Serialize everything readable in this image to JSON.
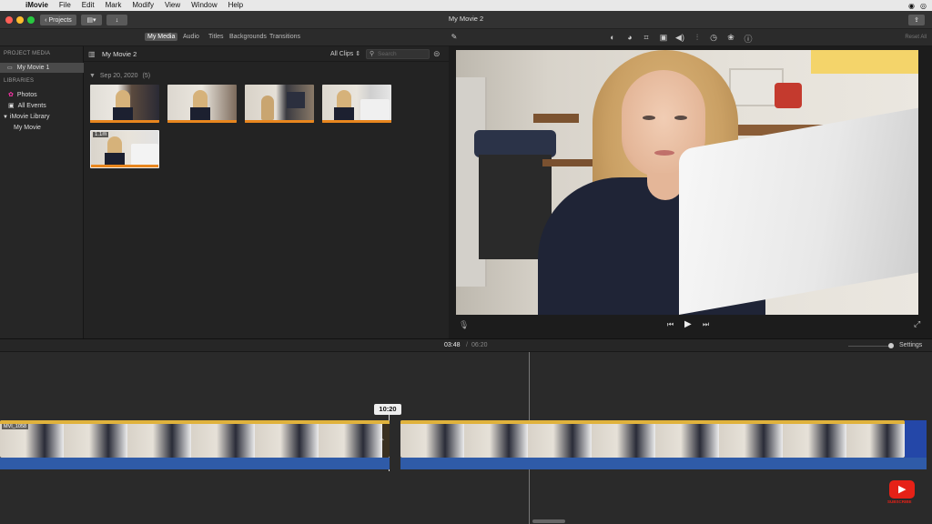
{
  "menubar": {
    "app_name": "iMovie",
    "items": [
      "File",
      "Edit",
      "Mark",
      "Modify",
      "View",
      "Window",
      "Help"
    ]
  },
  "titlebar": {
    "projects_label": "Projects",
    "title": "My Movie 2"
  },
  "media_tabs": [
    "My Media",
    "Audio",
    "Titles",
    "Backgrounds",
    "Transitions"
  ],
  "viewer_tools": {
    "reset_label": "Reset All"
  },
  "sidebar": {
    "project_media_heading": "PROJECT MEDIA",
    "project_item": "My Movie 1",
    "libraries_heading": "LIBRARIES",
    "photos": "Photos",
    "all_events": "All Events",
    "library": "iMovie Library",
    "event": "My Movie"
  },
  "browser": {
    "title": "My Movie 2",
    "filter": "All Clips",
    "search_placeholder": "Search",
    "date_header": "Sep 20, 2020",
    "date_count": "(5)",
    "selected_duration": "1.1m"
  },
  "timeline": {
    "current_time": "03:48",
    "separator": "/",
    "total_time": "06:20",
    "settings_label": "Settings",
    "skim_time": "10:20",
    "clip_label": "MVI_1058",
    "zoom_level": 0.95
  },
  "watermark": {
    "label": "SUBSCRIBE"
  },
  "colors": {
    "accent_orange": "#e8861e",
    "audio_blue": "#2f5ba8",
    "yt_red": "#e62117"
  }
}
